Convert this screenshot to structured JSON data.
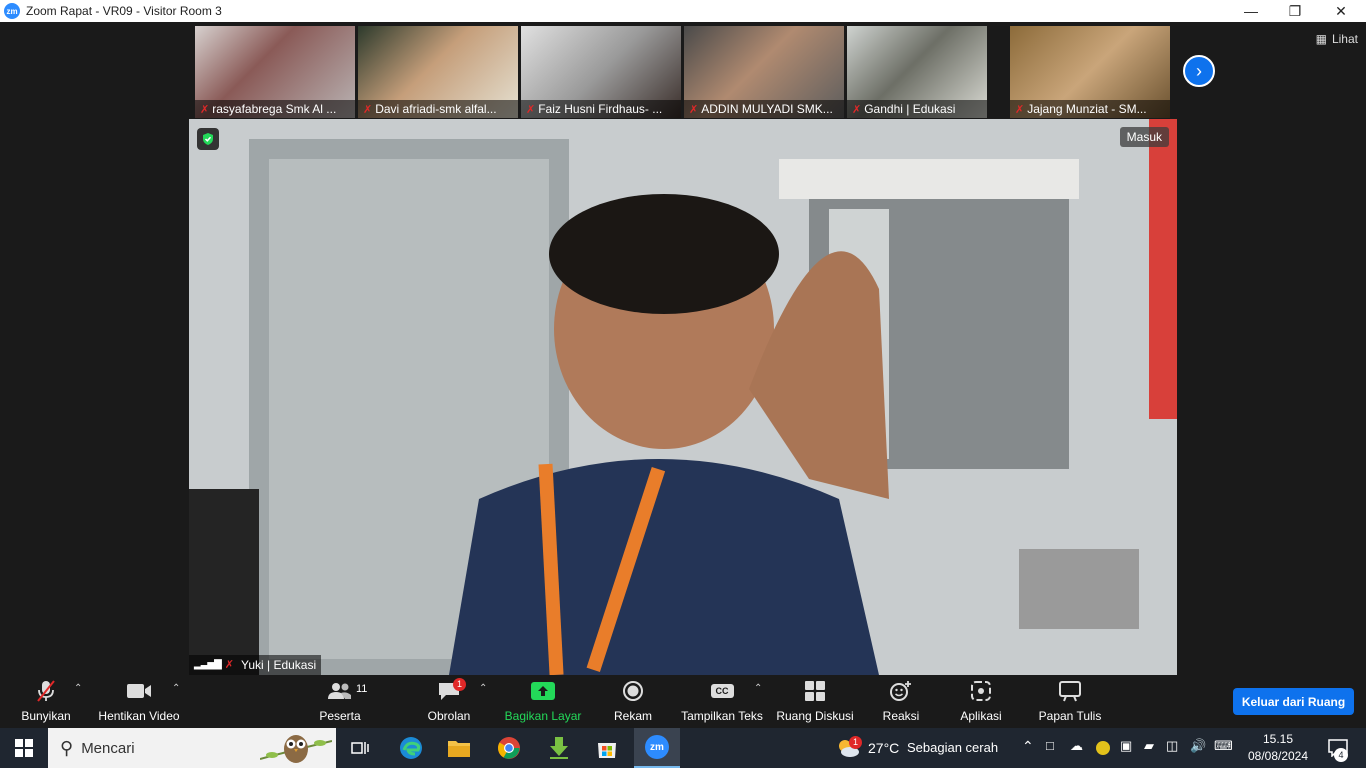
{
  "window": {
    "app_logo": "zm",
    "title": "Zoom Rapat - VR09 - Visitor Room 3"
  },
  "gallery": {
    "participants": [
      {
        "name": "rasyafabrega Smk Al ..."
      },
      {
        "name": "Davi afriadi-smk alfal..."
      },
      {
        "name": "Faiz Husni Firdhaus- ..."
      },
      {
        "name": "ADDIN MULYADI SMK..."
      },
      {
        "name": "Gandhi | Edukasi"
      },
      {
        "name": "Jajang Munziat - SM..."
      }
    ],
    "view_label": "Lihat"
  },
  "main_video": {
    "speaker_name": "Yuki | Edukasi",
    "status_label": "Masuk"
  },
  "toolbar": {
    "unmute": "Bunyikan",
    "stop_video": "Hentikan Video",
    "participants": "Peserta",
    "participants_count": "11",
    "chat": "Obrolan",
    "chat_badge": "1",
    "share": "Bagikan Layar",
    "record": "Rekam",
    "captions": "Tampilkan Teks",
    "captions_icon": "CC",
    "breakout": "Ruang Diskusi",
    "reactions": "Reaksi",
    "apps": "Aplikasi",
    "whiteboard": "Papan Tulis",
    "leave": "Keluar dari Ruang"
  },
  "taskbar": {
    "search_placeholder": "Mencari",
    "zoom_icon_label": "zm",
    "weather_temp": "27°C",
    "weather_desc": "Sebagian cerah",
    "weather_badge": "1",
    "time": "15.15",
    "date": "08/08/2024",
    "notifications": "4"
  },
  "colors": {
    "accent": "#0e72ed",
    "mute_red": "#e02828",
    "share_green": "#23d959"
  }
}
